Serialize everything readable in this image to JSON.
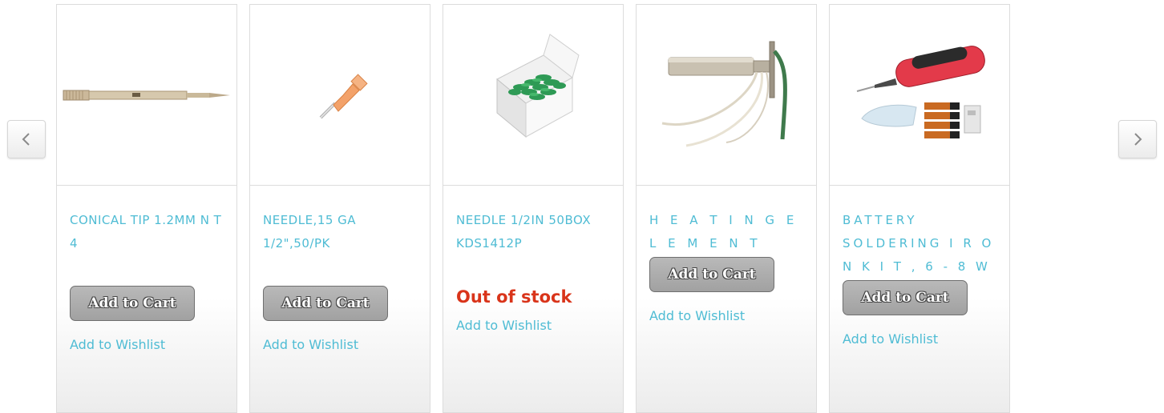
{
  "carousel": {
    "prev_icon": "chevron-left-icon",
    "next_icon": "chevron-right-icon",
    "products": [
      {
        "title": "CONICAL TIP 1.2MM N T 4",
        "action": "Add to Cart",
        "wishlist": "Add to Wishlist",
        "image": "conical-tip-image"
      },
      {
        "title": "NEEDLE,15 GA 1/2\",50/PK",
        "action": "Add to Cart",
        "wishlist": "Add to Wishlist",
        "image": "needle-image"
      },
      {
        "title": "NEEDLE 1/2IN 50BOX KDS1412P",
        "stock_status": "Out of stock",
        "wishlist": "Add to Wishlist",
        "image": "needle-box-image"
      },
      {
        "title": "H E A T I N G E L E M E N T",
        "action": "Add to Cart",
        "wishlist": "Add to Wishlist",
        "image": "heating-element-image"
      },
      {
        "title": "BATTERY SOLDERING I R O N K I T , 6 - 8 W",
        "action": "Add to Cart",
        "wishlist": "Add to Wishlist",
        "image": "battery-soldering-kit-image"
      }
    ]
  },
  "colors": {
    "link": "#4fbcd4",
    "out_of_stock": "#d9341a",
    "button_gray": "#a9a9a9"
  }
}
